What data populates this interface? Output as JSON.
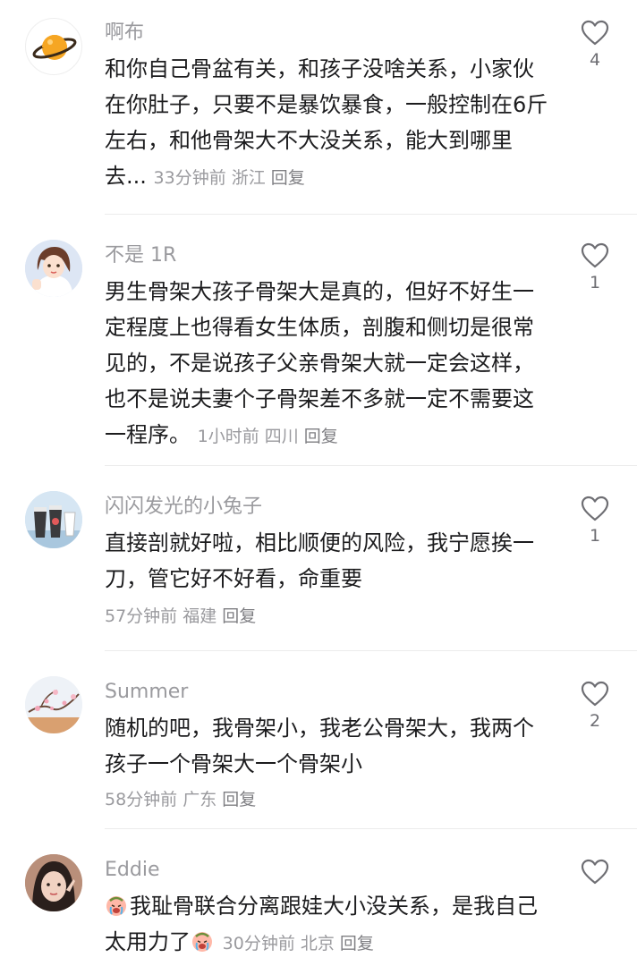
{
  "comments": [
    {
      "username": "啊布",
      "text": "和你自己骨盆有关，和孩子没啥关系，小家伙在你肚子，只要不是暴饮暴食，一般控制在6斤左右，和他骨架大不大没关系，能大到哪里去...",
      "time": "33分钟前",
      "location": "浙江",
      "reply": "回复",
      "likes": "4",
      "avatar_icon": "planet-icon"
    },
    {
      "username": "不是 1R",
      "text": "男生骨架大孩子骨架大是真的，但好不好生一定程度上也得看女生体质，剖腹和侧切是很常见的，不是说孩子父亲骨架大就一定会这样，也不是说夫妻个子骨架差不多就一定不需要这一程序。",
      "time": "1小时前",
      "location": "四川",
      "reply": "回复",
      "likes": "1",
      "avatar_icon": "cartoon-girl-avatar"
    },
    {
      "username": "闪闪发光的小兔子",
      "text": "直接剖就好啦，相比顺便的风险，我宁愿挨一刀，管它好不好看，命重要",
      "time": "57分钟前",
      "location": "福建",
      "reply": "回复",
      "likes": "1",
      "avatar_icon": "cups-photo-avatar"
    },
    {
      "username": "Summer",
      "text": "随机的吧，我骨架小，我老公骨架大，我两个孩子一个骨架大一个骨架小",
      "time": "58分钟前",
      "location": "广东",
      "reply": "回复",
      "likes": "2",
      "avatar_icon": "plum-blossom-avatar"
    },
    {
      "username": "Eddie",
      "text_part1": "我耻骨联合分离跟娃大小没关系，是我自己太用力了",
      "time": "30分钟前",
      "location": "北京",
      "reply": "回复",
      "likes": "",
      "avatar_icon": "selfie-avatar"
    }
  ],
  "colors": {
    "username": "#9a9a9e",
    "text": "#1c1c1e",
    "meta": "#9a9a9e",
    "divider": "#ececec"
  }
}
